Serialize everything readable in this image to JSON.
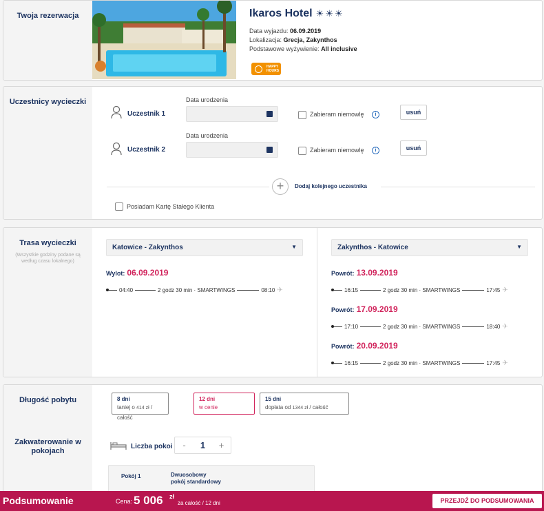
{
  "reservation": {
    "section_title": "Twoja rezerwacja",
    "hotel_name": "Ikaros Hotel",
    "stars_icons": [
      "sun-star-icon",
      "sun-star-icon",
      "half-sun-star-icon"
    ],
    "departure_label": "Data wyjazdu:",
    "departure_value": "06.09.2019",
    "location_label": "Lokalizacja:",
    "location_value": "Grecja, Zakynthos",
    "board_label": "Podstawowe wyżywienie:",
    "board_value": "All inclusive",
    "badge_line1": "HAPPY",
    "badge_line2": "HOURS"
  },
  "participants": {
    "section_title": "Uczestnicy wycieczki",
    "items": [
      {
        "name": "Uczestnik 1",
        "date_label": "Data urodzenia",
        "infant_label": "Zabieram niemowlę",
        "remove_label": "usuń"
      },
      {
        "name": "Uczestnik 2",
        "date_label": "Data urodzenia",
        "infant_label": "Zabieram niemowlę",
        "remove_label": "usuń"
      }
    ],
    "add_label": "Dodaj kolejnego uczestnika",
    "loyalty_label": "Posiadam Kartę Stałego Klienta"
  },
  "route": {
    "section_title": "Trasa wycieczki",
    "section_subtitle": "(Wszystkie godziny podane są według czasu lokalnego)",
    "outbound": {
      "select_value": "Katowice - Zakynthos",
      "label": "Wylot:",
      "date": "06.09.2019",
      "flight": {
        "dep": "04:40",
        "info": "2 godz 30 min · SMARTWINGS",
        "arr": "08:10"
      }
    },
    "return": {
      "select_value": "Zakynthos - Katowice",
      "options": [
        {
          "label": "Powrót:",
          "date": "13.09.2019",
          "dep": "16:15",
          "info": "2 godz 30 min · SMARTWINGS",
          "arr": "17:45"
        },
        {
          "label": "Powrót:",
          "date": "17.09.2019",
          "dep": "17:10",
          "info": "2 godz 30 min · SMARTWINGS",
          "arr": "18:40"
        },
        {
          "label": "Powrót:",
          "date": "20.09.2019",
          "dep": "16:15",
          "info": "2 godz 30 min · SMARTWINGS",
          "arr": "17:45"
        }
      ]
    }
  },
  "stay": {
    "section_title": "Długość pobytu",
    "options": [
      {
        "days": "8 dni",
        "price_pre": "taniej o",
        "price_num": "414 zł",
        "price_post": "/ całość"
      },
      {
        "days": "12 dni",
        "price_text": "w cenie"
      },
      {
        "days": "15 dni",
        "price_pre": "dopłata od",
        "price_num": "1344 zł",
        "price_post": "/ całość"
      }
    ]
  },
  "rooms": {
    "section_title": "Zakwaterowanie w pokojach",
    "count_label": "Liczba pokoi",
    "minus": "-",
    "count": "1",
    "plus": "+",
    "room_label": "Pokój 1",
    "room_type_line1": "Dwuosobowy",
    "room_type_line2": "pokój standardowy"
  },
  "footer": {
    "title": "Podsumowanie",
    "price_label": "Cena:",
    "price_value": "5 006",
    "currency": "zł",
    "price_suffix": "za całość / 12 dni",
    "cta": "PRZEJDŹ DO PODSUMOWANIA"
  },
  "colors": {
    "navy": "#1d3461",
    "accent": "#d1245c",
    "footer": "#b8164f",
    "badge": "#f29100"
  }
}
